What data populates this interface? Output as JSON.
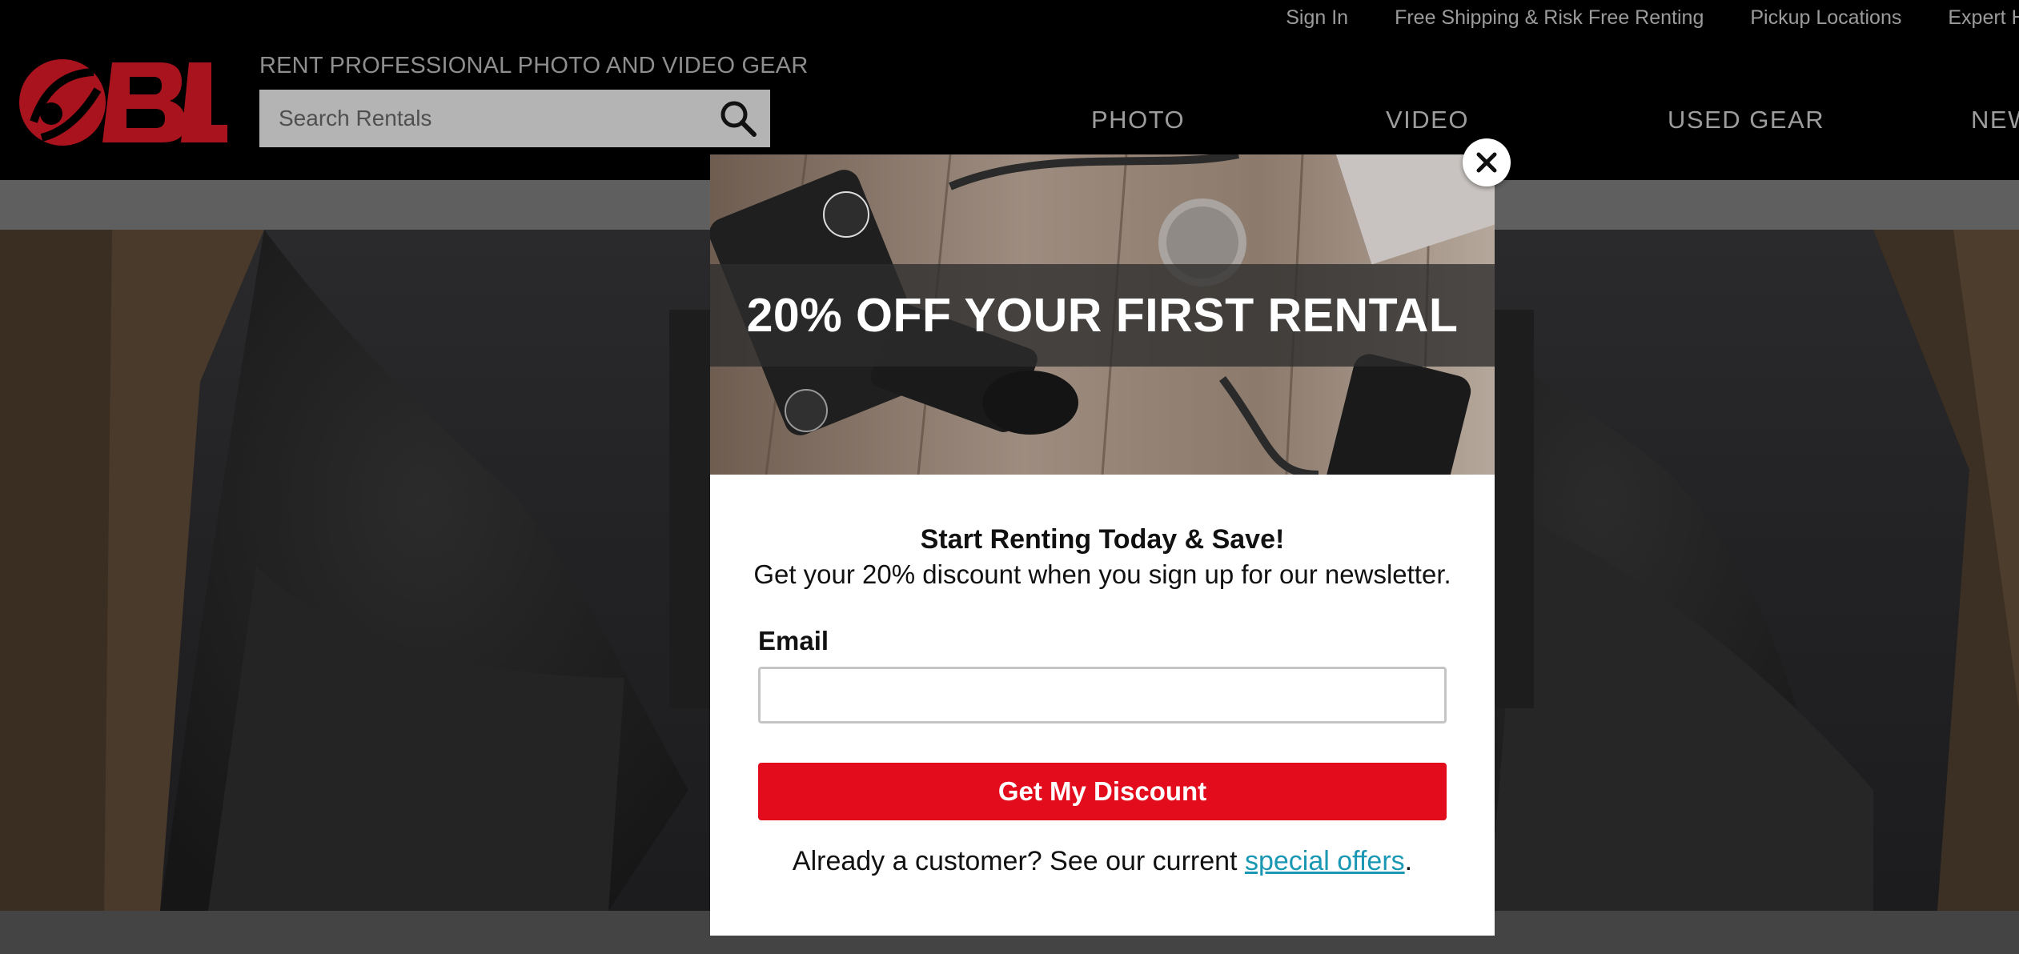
{
  "utility_nav": {
    "items": [
      "Sign In",
      "Free Shipping & Risk Free Renting",
      "Pickup Locations",
      "Expert Help"
    ]
  },
  "header": {
    "logo_text": "BL",
    "tagline": "RENT PROFESSIONAL PHOTO AND VIDEO GEAR",
    "search_placeholder": "Search Rentals",
    "search_icon": "search-icon"
  },
  "main_nav": {
    "items": [
      "PHOTO",
      "VIDEO",
      "USED GEAR",
      "NEW"
    ]
  },
  "modal": {
    "banner_headline": "20% OFF YOUR FIRST RENTAL",
    "heading": "Start Renting Today & Save!",
    "subheading": "Get your 20% discount when you sign up for our newsletter.",
    "email_label": "Email",
    "email_value": "",
    "cta_label": "Get My Discount",
    "footer_prefix": "Already a customer? See our current ",
    "footer_link": "special offers",
    "footer_suffix": ".",
    "close_icon": "close-icon"
  },
  "colors": {
    "brand_red": "#a8131e",
    "cta_red": "#e20c1c",
    "link_teal": "#1a97b3"
  }
}
